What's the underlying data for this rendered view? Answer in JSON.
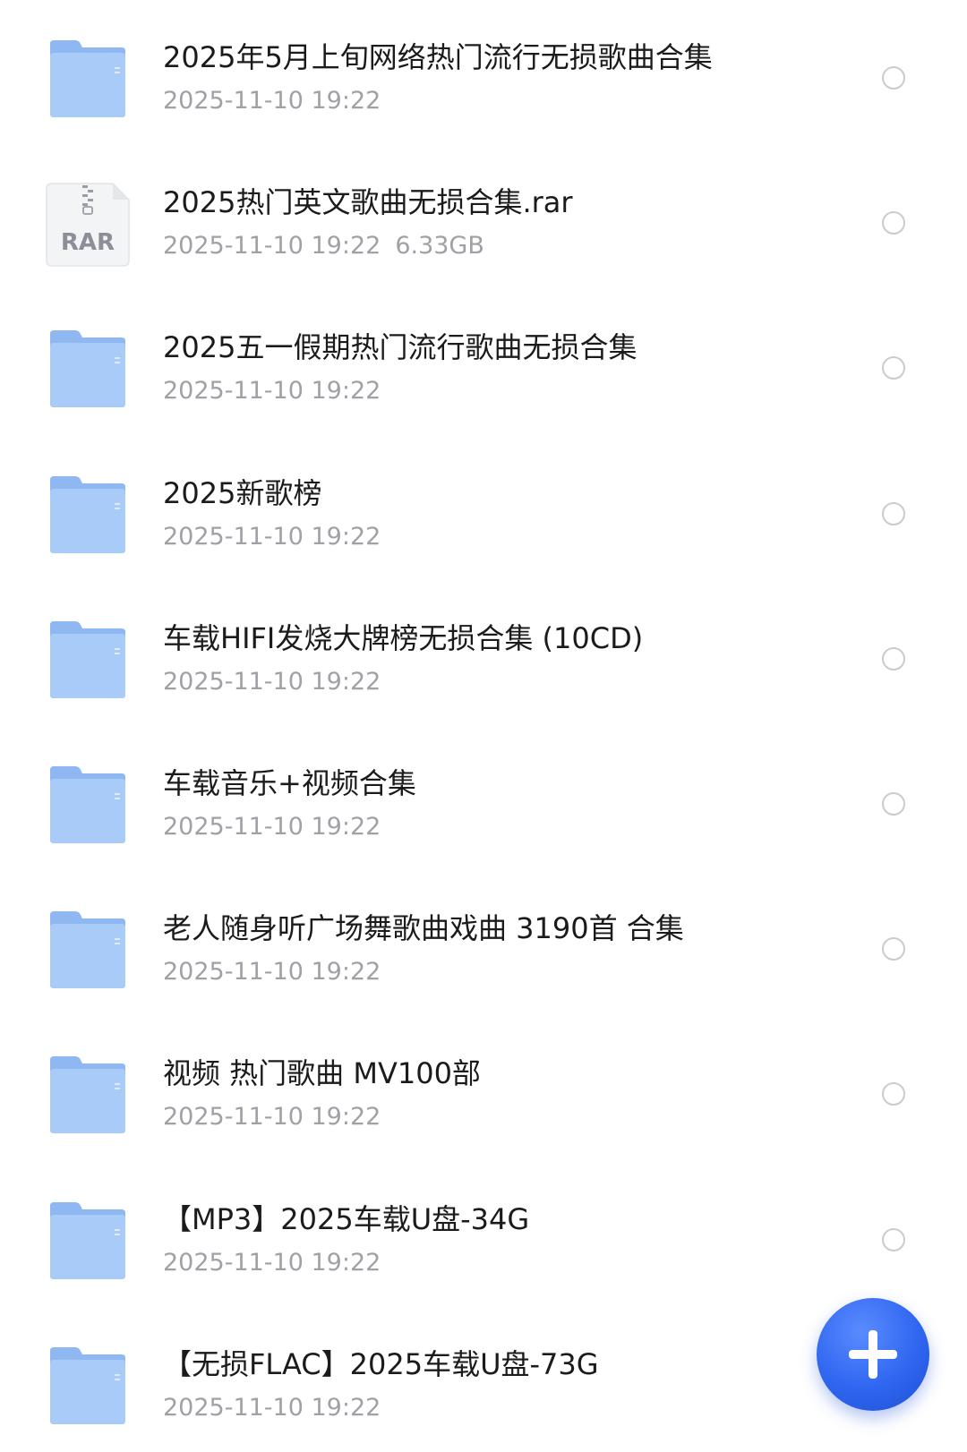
{
  "colors": {
    "folder_back": "#8fb8f2",
    "folder_front": "#a8cbf7",
    "title_text": "#1b1b1b",
    "meta_text": "#9fa1a6",
    "fab": "#2f66f0",
    "rar_label": "#8c8f98"
  },
  "files": [
    {
      "icon": "folder-icon",
      "name": "2025年5月上旬网络热门流行无损歌曲合集",
      "date": "2025-11-10 19:22",
      "size": ""
    },
    {
      "icon": "rar-archive-icon",
      "name": "2025热门英文歌曲无损合集.rar",
      "date": "2025-11-10 19:22",
      "size": "6.33GB",
      "badge": "RAR"
    },
    {
      "icon": "folder-icon",
      "name": "2025五一假期热门流行歌曲无损合集",
      "date": "2025-11-10 19:22",
      "size": ""
    },
    {
      "icon": "folder-icon",
      "name": "2025新歌榜",
      "date": "2025-11-10 19:22",
      "size": ""
    },
    {
      "icon": "folder-icon",
      "name": "车载HIFI发烧大牌榜无损合集 (10CD)",
      "date": "2025-11-10 19:22",
      "size": ""
    },
    {
      "icon": "folder-icon",
      "name": "车载音乐+视频合集",
      "date": "2025-11-10 19:22",
      "size": ""
    },
    {
      "icon": "folder-icon",
      "name": "老人随身听广场舞歌曲戏曲 3190首 合集",
      "date": "2025-11-10 19:22",
      "size": ""
    },
    {
      "icon": "folder-icon",
      "name": "视频  热门歌曲  MV100部",
      "date": "2025-11-10 19:22",
      "size": ""
    },
    {
      "icon": "folder-icon",
      "name": "【MP3】2025车载U盘-34G",
      "date": "2025-11-10 19:22",
      "size": ""
    },
    {
      "icon": "folder-icon",
      "name": "【无损FLAC】2025车载U盘-73G",
      "date": "2025-11-10 19:22",
      "size": ""
    }
  ],
  "fab": {
    "icon": "plus-icon"
  }
}
